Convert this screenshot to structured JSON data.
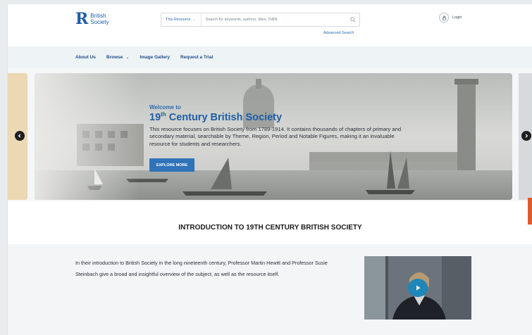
{
  "brand": {
    "name_line1": "British",
    "name_line2": "Society"
  },
  "search": {
    "scope": "This Resource",
    "placeholder": "Search for keywords, authors, titles, ISBN",
    "advanced": "Advanced Search"
  },
  "login": {
    "label": "Login"
  },
  "nav": {
    "items": [
      "About Us",
      "Browse",
      "Image Gallery",
      "Request a Trial"
    ]
  },
  "hero": {
    "pre_title": "Welcome to",
    "title_num": "19",
    "title_sup": "th",
    "title_rest": " Century British Society",
    "description": "This resource focuses on British Society from 1789-1914. It contains thousands of chapters of primary and secondary material, searchable by Theme, Region, Period and Notable Figures, making it an invaluable resource for students and researchers.",
    "button": "EXPLORE MORE"
  },
  "intro": {
    "heading": "INTRODUCTION TO 19TH CENTURY BRITISH SOCIETY",
    "text": "In their introduction to British Society in the long nineteenth century, Professor Martin Hewitt and Professor Susie Steinbach give a broad and insightful overview of the subject, as well as the resource itself."
  },
  "colors": {
    "accent": "#1d5ea8",
    "button": "#2f73b9",
    "play": "#1f86b8",
    "tab": "#e05a2b"
  }
}
